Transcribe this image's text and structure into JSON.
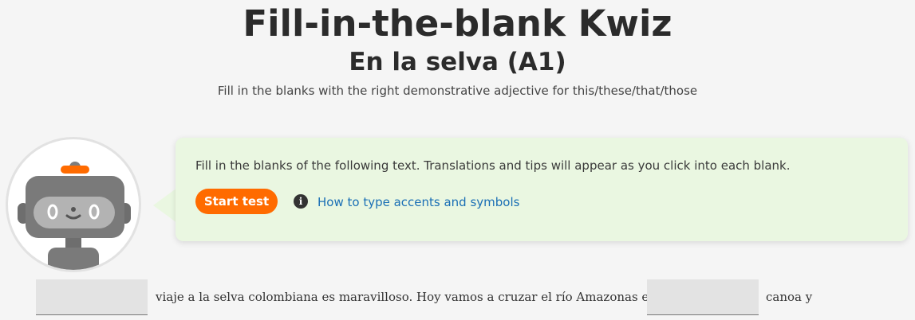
{
  "header": {
    "title": "Fill-in-the-blank Kwiz",
    "subtitle": "En la selva (A1)",
    "instructions": "Fill in the blanks with the right demonstrative adjective for this/these/that/those"
  },
  "panel": {
    "text": "Fill in the blanks of the following text. Translations and tips will appear as you click into each blank.",
    "start_button": "Start test",
    "info_icon": "i",
    "help_link": "How to type accents and symbols"
  },
  "exercise": {
    "blank_1_value": "",
    "segment_1": "viaje a la selva colombiana es maravilloso.  Hoy vamos a cruzar el río Amazonas en",
    "blank_2_value": "",
    "segment_2": "canoa  y"
  },
  "colors": {
    "accent": "#ff6b00",
    "panel_bg": "#eaf7e1",
    "link": "#1a6fb5"
  },
  "icons": {
    "avatar": "robot-avatar-icon",
    "info": "info-circle-icon"
  }
}
